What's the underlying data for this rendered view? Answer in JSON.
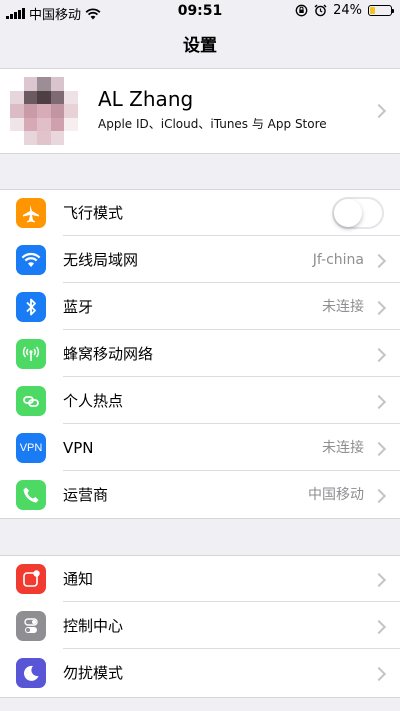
{
  "status_bar": {
    "carrier": "中国移动",
    "time": "09:51",
    "battery": "24%",
    "battery_level": 0.24
  },
  "nav": {
    "title": "设置"
  },
  "profile": {
    "name": "AL Zhang",
    "subtitle": "Apple ID、iCloud、iTunes 与 App Store"
  },
  "group1": [
    {
      "label": "飞行模式",
      "icon": "airplane-icon",
      "color": "#ff9500",
      "toggle": false
    },
    {
      "label": "无线局域网",
      "value": "Jf-china",
      "icon": "wifi-icon",
      "color": "#1a7cf5"
    },
    {
      "label": "蓝牙",
      "value": "未连接",
      "icon": "bluetooth-icon",
      "color": "#1a7cf5"
    },
    {
      "label": "蜂窝移动网络",
      "icon": "cellular-antenna-icon",
      "color": "#4cd964"
    },
    {
      "label": "个人热点",
      "icon": "hotspot-icon",
      "color": "#4cd964"
    },
    {
      "label": "VPN",
      "value": "未连接",
      "icon": "vpn-icon",
      "icon_text": "VPN",
      "color": "#1a7cf5"
    },
    {
      "label": "运营商",
      "value": "中国移动",
      "icon": "phone-icon",
      "color": "#4cd964"
    }
  ],
  "group2": [
    {
      "label": "通知",
      "icon": "notifications-icon",
      "color": "#f23b30"
    },
    {
      "label": "控制中心",
      "icon": "control-center-icon",
      "color": "#8e8e93"
    },
    {
      "label": "勿扰模式",
      "icon": "moon-icon",
      "color": "#5856d6"
    }
  ]
}
